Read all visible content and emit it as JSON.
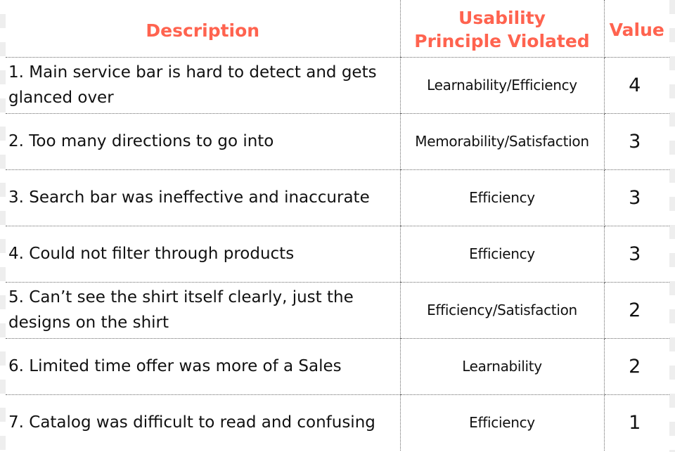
{
  "table": {
    "headers": {
      "description": "Description",
      "principle_line1": "Usability",
      "principle_line2": "Principle Violated",
      "value": "Value"
    },
    "rows": [
      {
        "description": "1. Main service bar is hard to detect and gets glanced over",
        "principle": "Learnability/Efficiency",
        "value": "4"
      },
      {
        "description": "2. Too many directions to go into",
        "principle": "Memorability/Satisfaction",
        "value": "3"
      },
      {
        "description": "3. Search bar was ineffective and inaccurate",
        "principle": "Efficiency",
        "value": "3"
      },
      {
        "description": "4. Could not filter through products",
        "principle": "Efficiency",
        "value": "3"
      },
      {
        "description": "5. Can’t see the shirt itself clearly, just the designs on the shirt",
        "principle": "Efficiency/Satisfaction",
        "value": "2"
      },
      {
        "description": "6. Limited time offer was more of a Sales",
        "principle": "Learnability",
        "value": "2"
      },
      {
        "description": "7. Catalog was difficult to read and confusing",
        "principle": "Efficiency",
        "value": "1"
      }
    ]
  },
  "colors": {
    "header_text": "#ff634f",
    "body_text": "#111111",
    "divider": "#6a6a6a"
  }
}
